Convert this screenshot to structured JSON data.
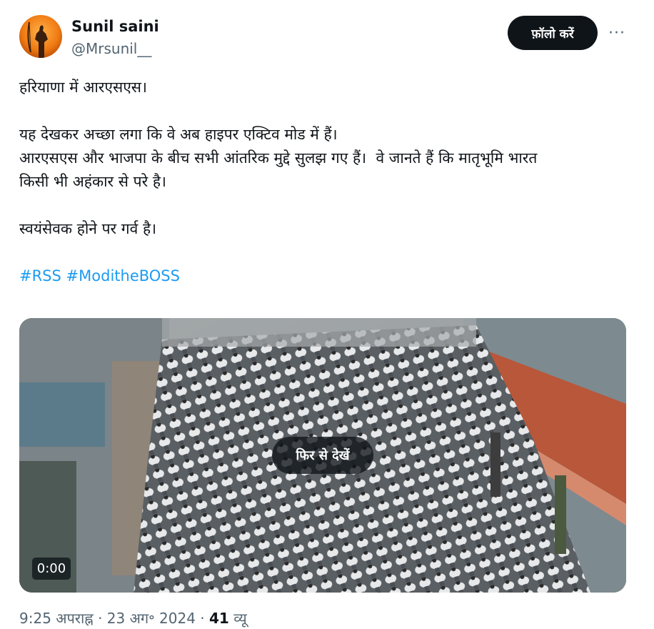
{
  "author": {
    "name": "Sunil saini",
    "handle": "@Mrsunil__",
    "avatar_icon": "saffron-avatar-icon"
  },
  "actions": {
    "follow_label": "फ़ॉलो करें",
    "more_label": "···"
  },
  "tweet": {
    "line1": "हरियाणा में आरएसएस।",
    "line2": "यह देखकर अच्छा लगा कि वे अब हाइपर एक्टिव मोड में हैं।",
    "line3": "आरएसएस और भाजपा के बीच सभी आंतरिक मुद्दे सुलझ गए हैं।  वे जानते हैं कि मातृभूमि भारत",
    "line4": "किसी भी अहंकार से परे है।",
    "line5": "स्वयंसेवक होने पर गर्व है।",
    "hashtags": [
      "#RSS",
      "#ModitheBOSS"
    ]
  },
  "video": {
    "replay_label": "फिर से देखें",
    "time": "0:00"
  },
  "meta": {
    "time": "9:25 अपराह्न",
    "sep1": " · ",
    "date": "23 अग॰ 2024",
    "sep2": " · ",
    "views_count": "41",
    "views_label": " व्यू"
  },
  "colors": {
    "accent": "#1d9bf0",
    "text": "#0f1419",
    "secondary": "#536471",
    "follow_bg": "#0f1419"
  }
}
